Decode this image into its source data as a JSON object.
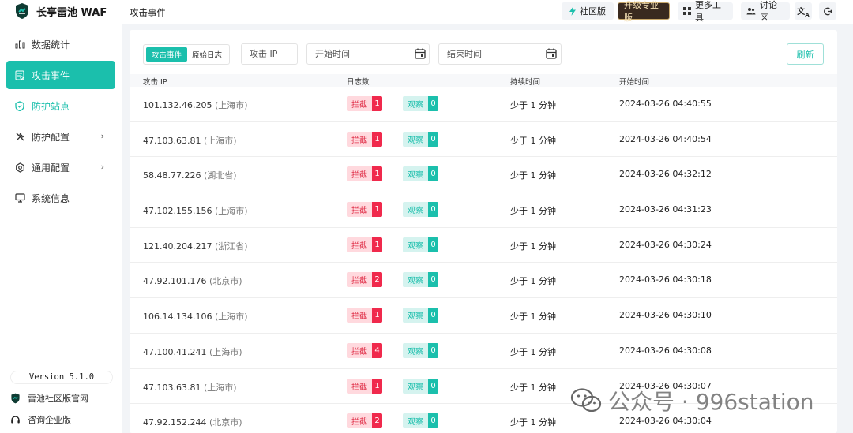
{
  "brand": {
    "name": "长亭雷池 WAF"
  },
  "topbar": {
    "page_title": "攻击事件",
    "community_label": "社区版",
    "upgrade_label": "升级专业版",
    "tools_label": "更多工具",
    "discuss_label": "讨论区",
    "lang_icon": "translate-icon",
    "logout_icon": "logout-icon"
  },
  "sidebar": {
    "items": [
      {
        "label": "数据统计",
        "icon": "bar-chart-icon"
      },
      {
        "label": "攻击事件",
        "icon": "document-icon"
      },
      {
        "label": "防护站点",
        "icon": "shield-icon"
      },
      {
        "label": "防护配置",
        "icon": "tools-icon"
      },
      {
        "label": "通用配置",
        "icon": "gear-icon"
      },
      {
        "label": "系统信息",
        "icon": "monitor-icon"
      }
    ],
    "version": "Version 5.1.0",
    "official_site": "雷池社区版官网",
    "enterprise": "咨询企业版"
  },
  "filters": {
    "tab_events": "攻击事件",
    "tab_logs": "原始日志",
    "ip_placeholder": "攻击 IP",
    "start_placeholder": "开始时间",
    "end_placeholder": "结束时间",
    "refresh_label": "刷新"
  },
  "table": {
    "headers": {
      "ip": "攻击 IP",
      "logs": "日志数",
      "duration": "持续时间",
      "start": "开始时间"
    },
    "block_label": "拦截",
    "watch_label": "观察",
    "rows": [
      {
        "ip": "101.132.46.205",
        "loc": "(上海市)",
        "block": "1",
        "watch": "0",
        "duration": "少于 1 分钟",
        "start": "2024-03-26 04:40:55"
      },
      {
        "ip": "47.103.63.81",
        "loc": "(上海市)",
        "block": "1",
        "watch": "0",
        "duration": "少于 1 分钟",
        "start": "2024-03-26 04:40:54"
      },
      {
        "ip": "58.48.77.226",
        "loc": "(湖北省)",
        "block": "1",
        "watch": "0",
        "duration": "少于 1 分钟",
        "start": "2024-03-26 04:32:12"
      },
      {
        "ip": "47.102.155.156",
        "loc": "(上海市)",
        "block": "1",
        "watch": "0",
        "duration": "少于 1 分钟",
        "start": "2024-03-26 04:31:23"
      },
      {
        "ip": "121.40.204.217",
        "loc": "(浙江省)",
        "block": "1",
        "watch": "0",
        "duration": "少于 1 分钟",
        "start": "2024-03-26 04:30:24"
      },
      {
        "ip": "47.92.101.176",
        "loc": "(北京市)",
        "block": "2",
        "watch": "0",
        "duration": "少于 1 分钟",
        "start": "2024-03-26 04:30:18"
      },
      {
        "ip": "106.14.134.106",
        "loc": "(上海市)",
        "block": "1",
        "watch": "0",
        "duration": "少于 1 分钟",
        "start": "2024-03-26 04:30:10"
      },
      {
        "ip": "47.100.41.241",
        "loc": "(上海市)",
        "block": "4",
        "watch": "0",
        "duration": "少于 1 分钟",
        "start": "2024-03-26 04:30:08"
      },
      {
        "ip": "47.103.63.81",
        "loc": "(上海市)",
        "block": "1",
        "watch": "0",
        "duration": "少于 1 分钟",
        "start": "2024-03-26 04:30:07"
      },
      {
        "ip": "47.92.152.244",
        "loc": "(北京市)",
        "block": "2",
        "watch": "0",
        "duration": "少于 1 分钟",
        "start": "2024-03-26 04:30:04"
      }
    ]
  },
  "watermark": {
    "text": "公众号 · 996station"
  },
  "colors": {
    "accent": "#1bbfac",
    "block": "#f0294c",
    "upgrade_bg": "#3a2a1f"
  }
}
